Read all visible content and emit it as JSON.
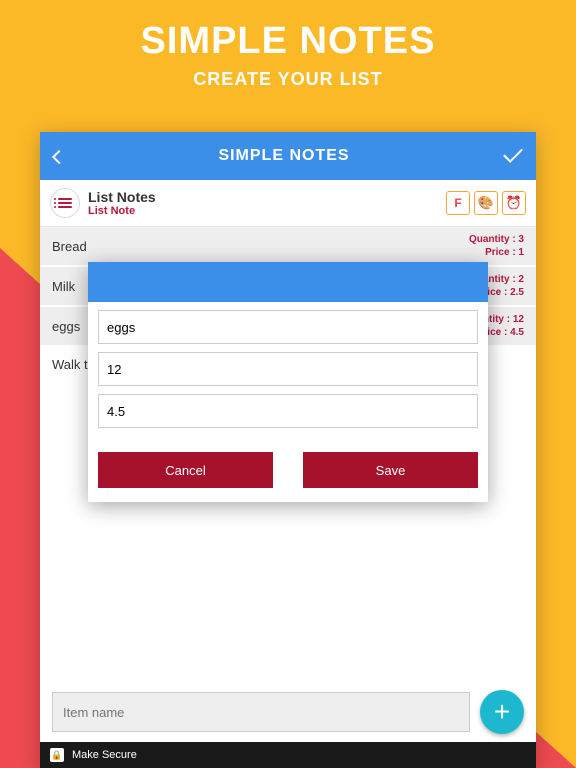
{
  "promo": {
    "title": "SIMPLE NOTES",
    "subtitle": "CREATE YOUR LIST"
  },
  "header": {
    "title": "SIMPLE NOTES"
  },
  "list": {
    "title": "List Notes",
    "subtitle": "List Note",
    "mini_icons": {
      "font": "F",
      "color": "🎨",
      "alarm": "⏰"
    },
    "items": [
      {
        "name": "Bread",
        "qty_label": "Quantity : 3",
        "price_label": "Price : 1"
      },
      {
        "name": "Milk",
        "qty_label": "Quantity : 2",
        "price_label": "Price : 2.5"
      },
      {
        "name": "eggs",
        "qty_label": "antity : 12",
        "price_label": "Price : 4.5"
      },
      {
        "name": "Walk th",
        "qty_label": "",
        "price_label": ""
      }
    ]
  },
  "modal": {
    "name": "eggs",
    "qty": "12",
    "price": "4.5",
    "cancel": "Cancel",
    "save": "Save"
  },
  "bottom": {
    "placeholder": "Item name",
    "add": "+"
  },
  "footer": {
    "lock": "🔒",
    "text": "Make Secure"
  }
}
